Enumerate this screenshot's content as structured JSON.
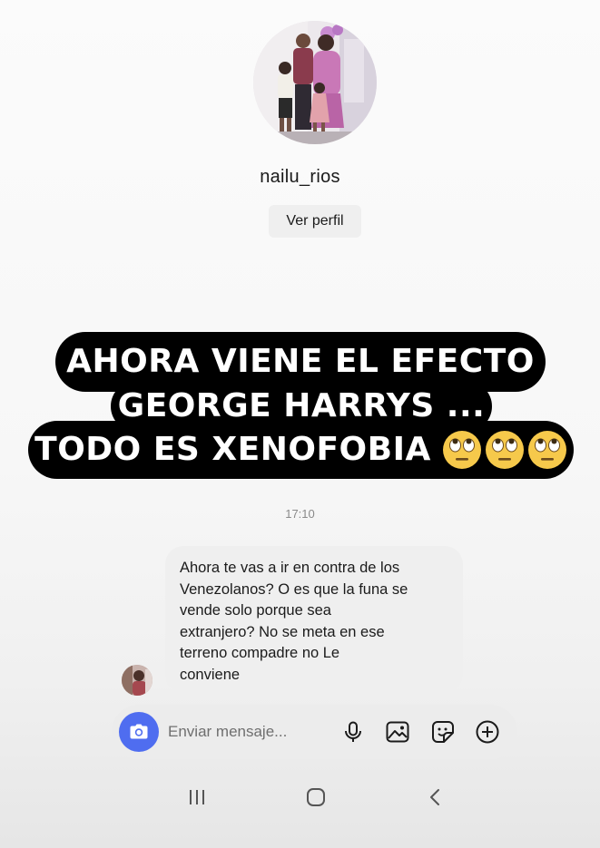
{
  "profile": {
    "username": "nailu_rios",
    "view_profile_label": "Ver perfil"
  },
  "caption": {
    "line1": "AHORA VIENE EL EFECTO",
    "line2": "GEORGE HARRYS ...",
    "line3": "TODO ES XENOFOBIA",
    "emoji": "face-with-rolling-eyes",
    "emoji_count": 3
  },
  "conversation": {
    "timestamp": "17:10",
    "message_lines": [
      "Ahora te vas a ir en contra de los",
      "Venezolanos? O es que la funa se",
      "vende solo porque sea",
      "extranjero? No se meta en ese",
      "terreno compadre no Le",
      "conviene"
    ]
  },
  "composer": {
    "placeholder": "Enviar mensaje...",
    "icons": [
      "camera-icon",
      "microphone-icon",
      "gallery-icon",
      "sticker-icon",
      "plus-icon"
    ]
  },
  "system_nav": {
    "icons": [
      "recent-apps-icon",
      "home-icon",
      "back-icon"
    ]
  },
  "colors": {
    "accent_blue": "#4f6df0",
    "caption_background": "#000000",
    "caption_text": "#ffffff",
    "bubble_background": "#efefef",
    "timestamp": "#8a8a8a"
  }
}
